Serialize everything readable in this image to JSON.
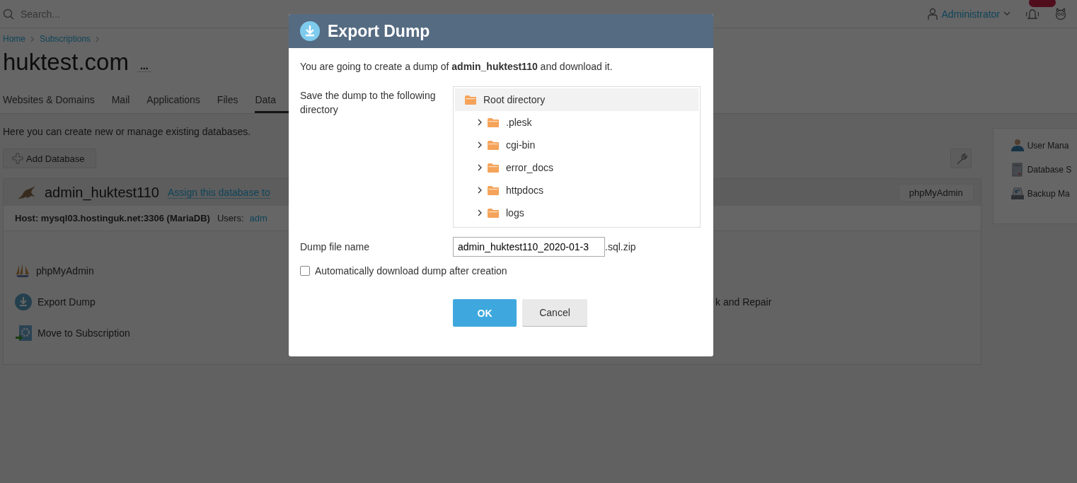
{
  "header": {
    "search": {
      "placeholder": "Search..."
    },
    "user": "Administrator"
  },
  "breadcrumbs": [
    "Home",
    "Subscriptions"
  ],
  "page_title": "huktest.com",
  "more_button": "...",
  "tabs": [
    {
      "label": "Websites & Domains",
      "selected": false
    },
    {
      "label": "Mail",
      "selected": false
    },
    {
      "label": "Applications",
      "selected": false
    },
    {
      "label": "Files",
      "selected": false
    },
    {
      "label": "Data",
      "selected": true
    }
  ],
  "description": "Here you can create new or manage existing databases.",
  "toolbar": {
    "add_button": "Add Database"
  },
  "database": {
    "name": "admin_huktest110",
    "assign_link": "Assign this database to",
    "header_button": "phpMyAdmin",
    "host": "Host: mysql03.hostinguk.net:3306 (MariaDB)",
    "users_label": "Users:",
    "users_link": "adm",
    "actions": [
      {
        "kind": "phpmyadmin",
        "label": "phpMyAdmin"
      },
      {
        "kind": "export",
        "label": "Export Dump"
      },
      {
        "kind": "move",
        "label": "Move to Subscription"
      }
    ],
    "actions_right": [
      {
        "label": "k and Repair"
      }
    ]
  },
  "sidebar": {
    "items": [
      {
        "kind": "users",
        "label": "User Mana"
      },
      {
        "kind": "server",
        "label": "Database S"
      },
      {
        "kind": "backup",
        "label": "Backup Ma"
      }
    ]
  },
  "dialog": {
    "title": "Export Dump",
    "intro": "You are going to create a dump of **admin_huktest110** and download it.",
    "directory_label": "Save the dump to the following directory",
    "tree": {
      "label": "Root directory",
      "selected": true,
      "expanded": true,
      "children": [
        {
          "label": ".plesk",
          "selected": false,
          "expanded": false
        },
        {
          "label": "cgi-bin",
          "selected": false,
          "expanded": false
        },
        {
          "label": "error_docs",
          "selected": false,
          "expanded": false
        },
        {
          "label": "httpdocs",
          "selected": false,
          "expanded": false
        },
        {
          "label": "logs",
          "selected": false,
          "expanded": false
        }
      ]
    },
    "file_label": "Dump file name",
    "file_value": "admin_huktest110_2020-01-3",
    "file_suffix": ".sql.zip",
    "auto_download": {
      "label": "Automatically download dump after creation",
      "checked": false
    },
    "buttons": [
      {
        "kind": "primary",
        "label": "OK"
      },
      {
        "kind": "secondary",
        "label": "Cancel"
      }
    ]
  }
}
